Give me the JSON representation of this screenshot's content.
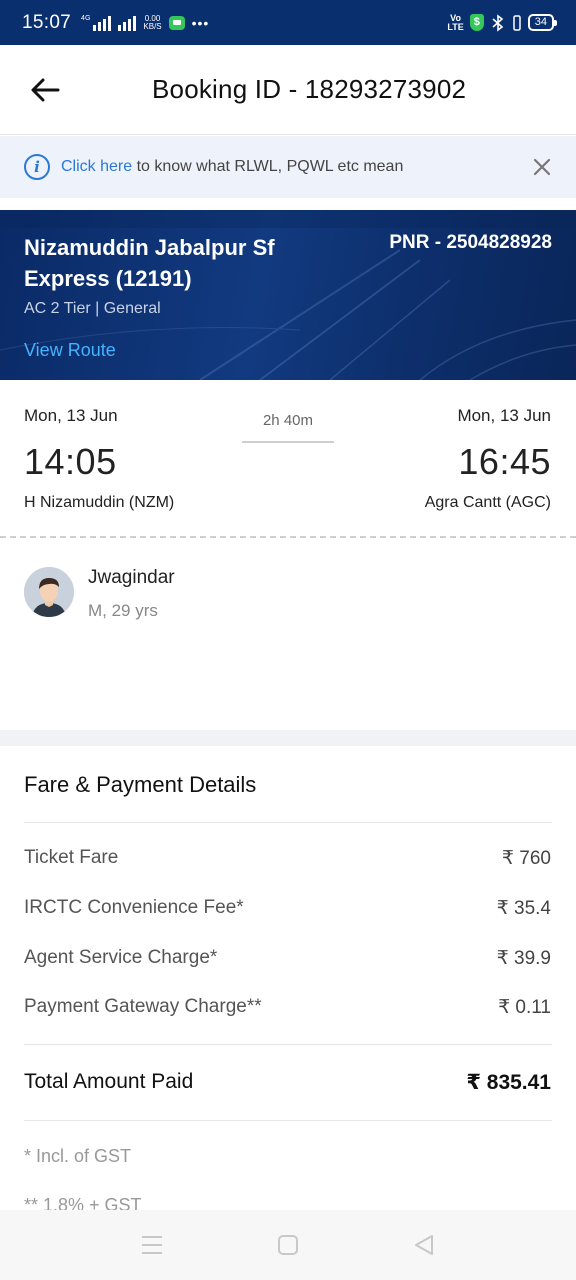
{
  "status_bar": {
    "time": "15:07",
    "network_label": "4G",
    "speed_value": "0.00",
    "speed_unit": "KB/S",
    "volte_top": "Vo",
    "volte_bottom": "LTE",
    "battery": "34",
    "icons": [
      "signal-icon",
      "message-icon",
      "more-dots-icon",
      "volte-icon",
      "shield-icon",
      "bluetooth-icon",
      "vibrate-icon",
      "battery-icon"
    ]
  },
  "header": {
    "title": "Booking ID - 18293273902"
  },
  "info_banner": {
    "link_text": "Click here",
    "text": " to know what RLWL, PQWL etc mean"
  },
  "train": {
    "name": "Nizamuddin Jabalpur Sf Express (12191)",
    "pnr": "PNR - 2504828928",
    "class_info": "AC 2 Tier | General",
    "view_route": "View Route"
  },
  "journey": {
    "departure": {
      "date": "Mon, 13 Jun",
      "time": "14:05",
      "station": "H Nizamuddin (NZM)"
    },
    "duration": "2h 40m",
    "arrival": {
      "date": "Mon, 13 Jun",
      "time": "16:45",
      "station": "Agra Cantt (AGC)"
    }
  },
  "passenger": {
    "name": "Jwagindar",
    "meta": "M, 29 yrs"
  },
  "fare": {
    "title": "Fare & Payment Details",
    "rows": [
      {
        "label": "Ticket Fare",
        "value": "₹ 760"
      },
      {
        "label": "IRCTC Convenience Fee*",
        "value": "₹ 35.4"
      },
      {
        "label": "Agent Service Charge*",
        "value": "₹ 39.9"
      },
      {
        "label": "Payment Gateway Charge**",
        "value": "₹ 0.11"
      }
    ],
    "total_label": "Total Amount Paid",
    "total_value": "₹ 835.41",
    "notes": [
      "* Incl. of GST",
      "** 1.8% + GST"
    ]
  },
  "colors": {
    "status_bar": "#0a2f6e",
    "banner_bg": "#0f367a",
    "link": "#2b78d8",
    "view_route": "#46b3ff"
  }
}
